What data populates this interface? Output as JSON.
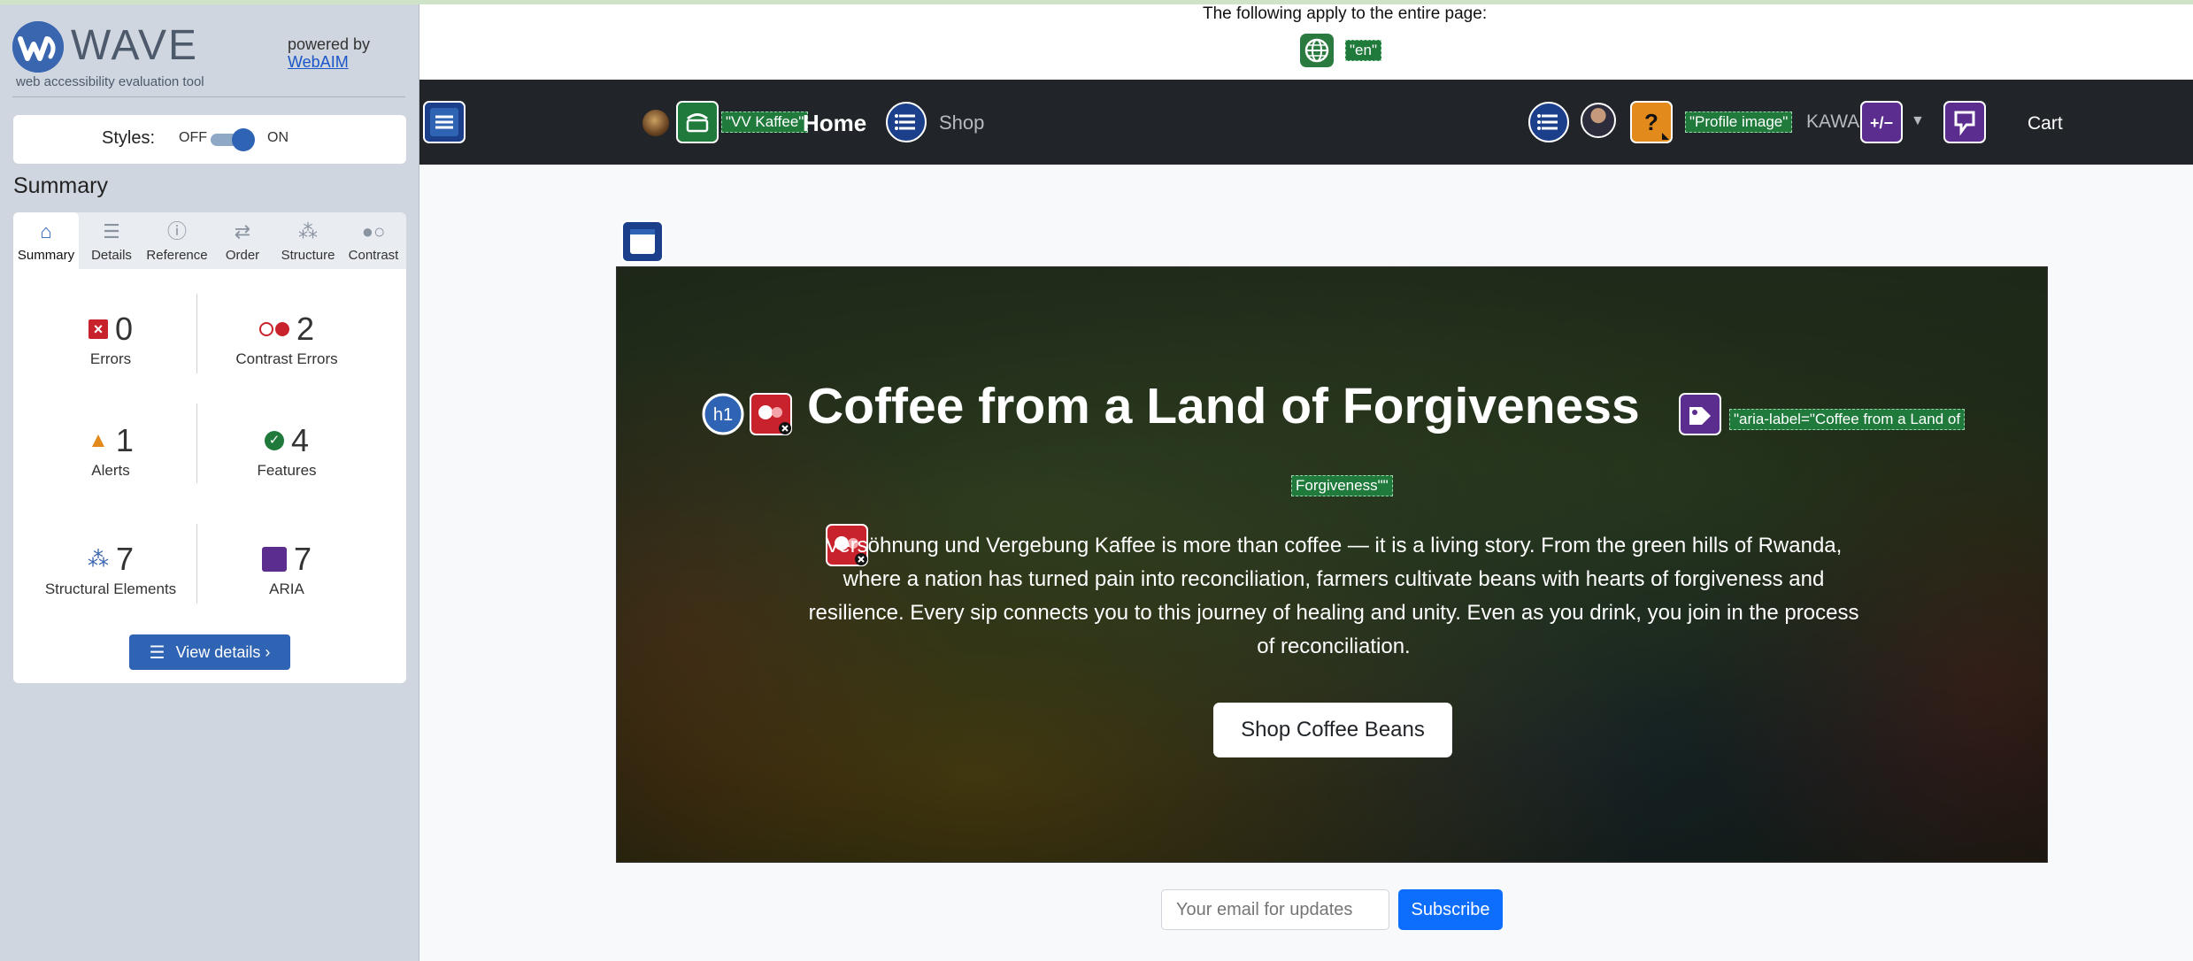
{
  "wave": {
    "wordmark": "WAVE",
    "tagline": "web accessibility evaluation tool",
    "powered_by": "powered by",
    "webaim": "WebAIM",
    "styles": {
      "label": "Styles:",
      "off": "OFF",
      "on": "ON",
      "state": "on"
    },
    "summary_title": "Summary",
    "tabs": [
      {
        "label": "Summary",
        "icon": "home-icon",
        "active": true
      },
      {
        "label": "Details",
        "icon": "list-icon",
        "active": false
      },
      {
        "label": "Reference",
        "icon": "info-icon",
        "active": false
      },
      {
        "label": "Order",
        "icon": "order-icon",
        "active": false
      },
      {
        "label": "Structure",
        "icon": "structure-icon",
        "active": false
      },
      {
        "label": "Contrast",
        "icon": "contrast-icon",
        "active": false
      }
    ],
    "stats": {
      "errors": {
        "count": "0",
        "label": "Errors"
      },
      "contrast_errors": {
        "count": "2",
        "label": "Contrast Errors"
      },
      "alerts": {
        "count": "1",
        "label": "Alerts"
      },
      "features": {
        "count": "4",
        "label": "Features"
      },
      "structural": {
        "count": "7",
        "label": "Structural Elements"
      },
      "aria": {
        "count": "7",
        "label": "ARIA"
      }
    },
    "view_details": "View details ›"
  },
  "page": {
    "apply_text": "The following apply to the entire page:",
    "lang_tag": "\"en\"",
    "nav": {
      "brand_tag": "\"VV Kaffee\"",
      "home": "Home",
      "shop": "Shop",
      "profile_tag": "\"Profile image\"",
      "kawa": "KAWA",
      "cart": "Cart"
    },
    "hero": {
      "h1_badge": "h1",
      "title": "Coffee from a Land of Forgiveness",
      "aria_tag_1": "\"aria-label=\"Coffee from a Land of",
      "aria_tag_2": "Forgiveness\"\"",
      "text": "Versöhnung und Vergebung Kaffee is more than coffee — it is a living story. From the green hills of Rwanda, where a nation has turned pain into reconciliation, farmers cultivate beans with hearts of forgiveness and resilience. Every sip connects you to this journey of healing and unity. Even as you drink, you join in the process of reconciliation.",
      "button": "Shop Coffee Beans"
    },
    "newsletter": {
      "placeholder": "Your email for updates",
      "button": "Subscribe"
    }
  },
  "colors": {
    "wave_blue": "#2f64b4",
    "error_red": "#c8232c",
    "feature_green": "#1f7a3c",
    "aria_purple": "#5b2d8e",
    "alert_orange": "#e28a1c",
    "navbar": "#212529",
    "subscribe_blue": "#0d6efd"
  }
}
